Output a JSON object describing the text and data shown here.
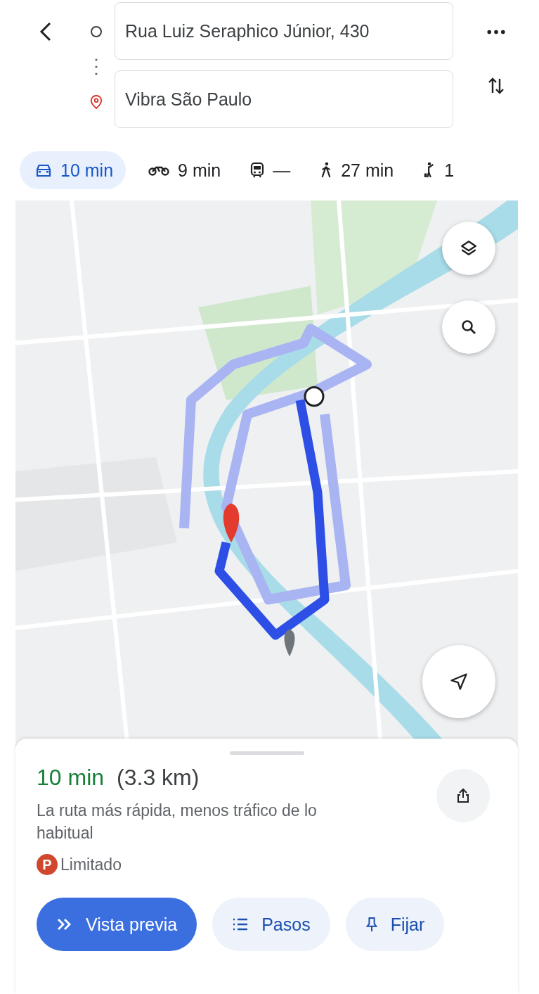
{
  "origin": {
    "value": "Rua Luiz Seraphico Júnior, 430"
  },
  "destination": {
    "value": "Vibra São Paulo"
  },
  "modes": [
    {
      "kind": "car",
      "label": "10 min",
      "selected": true
    },
    {
      "kind": "motorcycle",
      "label": "9 min",
      "selected": false
    },
    {
      "kind": "transit",
      "label": "—",
      "selected": false
    },
    {
      "kind": "walk",
      "label": "27 min",
      "selected": false
    },
    {
      "kind": "ride",
      "label": "1",
      "selected": false
    }
  ],
  "summary": {
    "duration": "10 min",
    "distance": "(3.3 km)",
    "description": "La ruta más rápida, menos tráfico de lo habitual",
    "parking": "Limitado",
    "parking_badge": "P"
  },
  "actions": [
    {
      "kind": "preview",
      "label": "Vista previa",
      "selected": true
    },
    {
      "kind": "steps",
      "label": "Pasos",
      "selected": false
    },
    {
      "kind": "pin",
      "label": "Fijar",
      "selected": false
    }
  ]
}
